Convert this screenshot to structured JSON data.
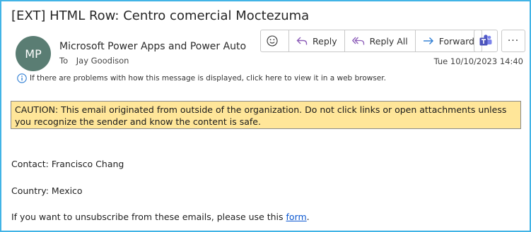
{
  "email": {
    "subject": "[EXT] HTML Row: Centro comercial Moctezuma",
    "sender_initials": "MP",
    "sender_name": "Microsoft Power Apps and Power Auto",
    "to_label": "To",
    "recipient": "Jay Goodison",
    "date": "Tue 10/10/2023 14:40",
    "info_message": "If there are problems with how this message is displayed, click here to view it in a web browser."
  },
  "toolbar": {
    "reply_label": "Reply",
    "reply_all_label": "Reply All",
    "forward_label": "Forward",
    "more_label": "···"
  },
  "body": {
    "caution": "CAUTION: This email originated from outside of the organization. Do not click links or open attachments unless you recognize the sender and know the content is safe.",
    "contact": "Contact: Francisco Chang",
    "country": "Country: Mexico",
    "unsubscribe_prefix": "If you want to unsubscribe from these emails, please use this ",
    "unsubscribe_link": "form",
    "unsubscribe_suffix": "."
  },
  "colors": {
    "frame_border": "#42b4e6",
    "avatar_bg": "#5a7d73",
    "caution_bg": "#ffe699",
    "link": "#0b57d0",
    "teams": "#4b53bc"
  }
}
